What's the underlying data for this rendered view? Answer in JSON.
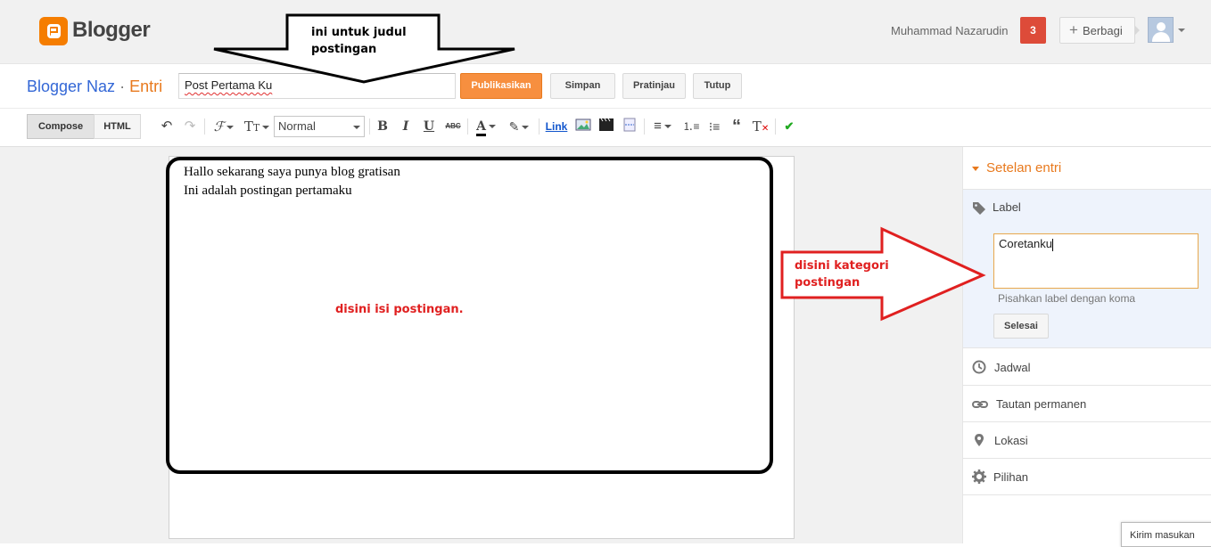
{
  "header": {
    "logo_text": "Blogger",
    "user_name": "Muhammad Nazarudin",
    "notification_count": "3",
    "share_label": "Berbagi"
  },
  "title_row": {
    "blog_name": "Blogger Naz",
    "separator": "·",
    "section": "Entri",
    "post_title_value": "Post Pertama Ku",
    "publish_label": "Publikasikan",
    "save_label": "Simpan",
    "preview_label": "Pratinjau",
    "close_label": "Tutup"
  },
  "toolbar": {
    "compose_tab": "Compose",
    "html_tab": "HTML",
    "paragraph_format": "Normal",
    "link_label": "Link"
  },
  "editor": {
    "lines": [
      "Hallo sekarang saya punya blog gratisan",
      "Ini adalah postingan pertamaku"
    ]
  },
  "sidebar": {
    "heading": "Setelan entri",
    "label_item": "Label",
    "label_input_value": "Coretanku",
    "label_hint": "Pisahkan label dengan koma",
    "done_label": "Selesai",
    "items": [
      {
        "label": "Jadwal",
        "icon": "clock-icon"
      },
      {
        "label": "Tautan permanen",
        "icon": "link-icon"
      },
      {
        "label": "Lokasi",
        "icon": "location-pin-icon"
      },
      {
        "label": "Pilihan",
        "icon": "gear-icon"
      }
    ]
  },
  "feedback_label": "Kirim masukan",
  "annotations": {
    "title_note": "ini untuk judul postingan",
    "content_note": "disini isi postingan.",
    "category_note": "disini kategori postingan"
  },
  "colors": {
    "brand_orange": "#f57d00",
    "accent_orange": "#e8791d",
    "publish_orange": "#f78f3f",
    "blog_name_blue": "#3367d6",
    "notification_red": "#dd4b39",
    "annotation_red": "#e02020",
    "label_panel_bg": "#eef3fc"
  }
}
